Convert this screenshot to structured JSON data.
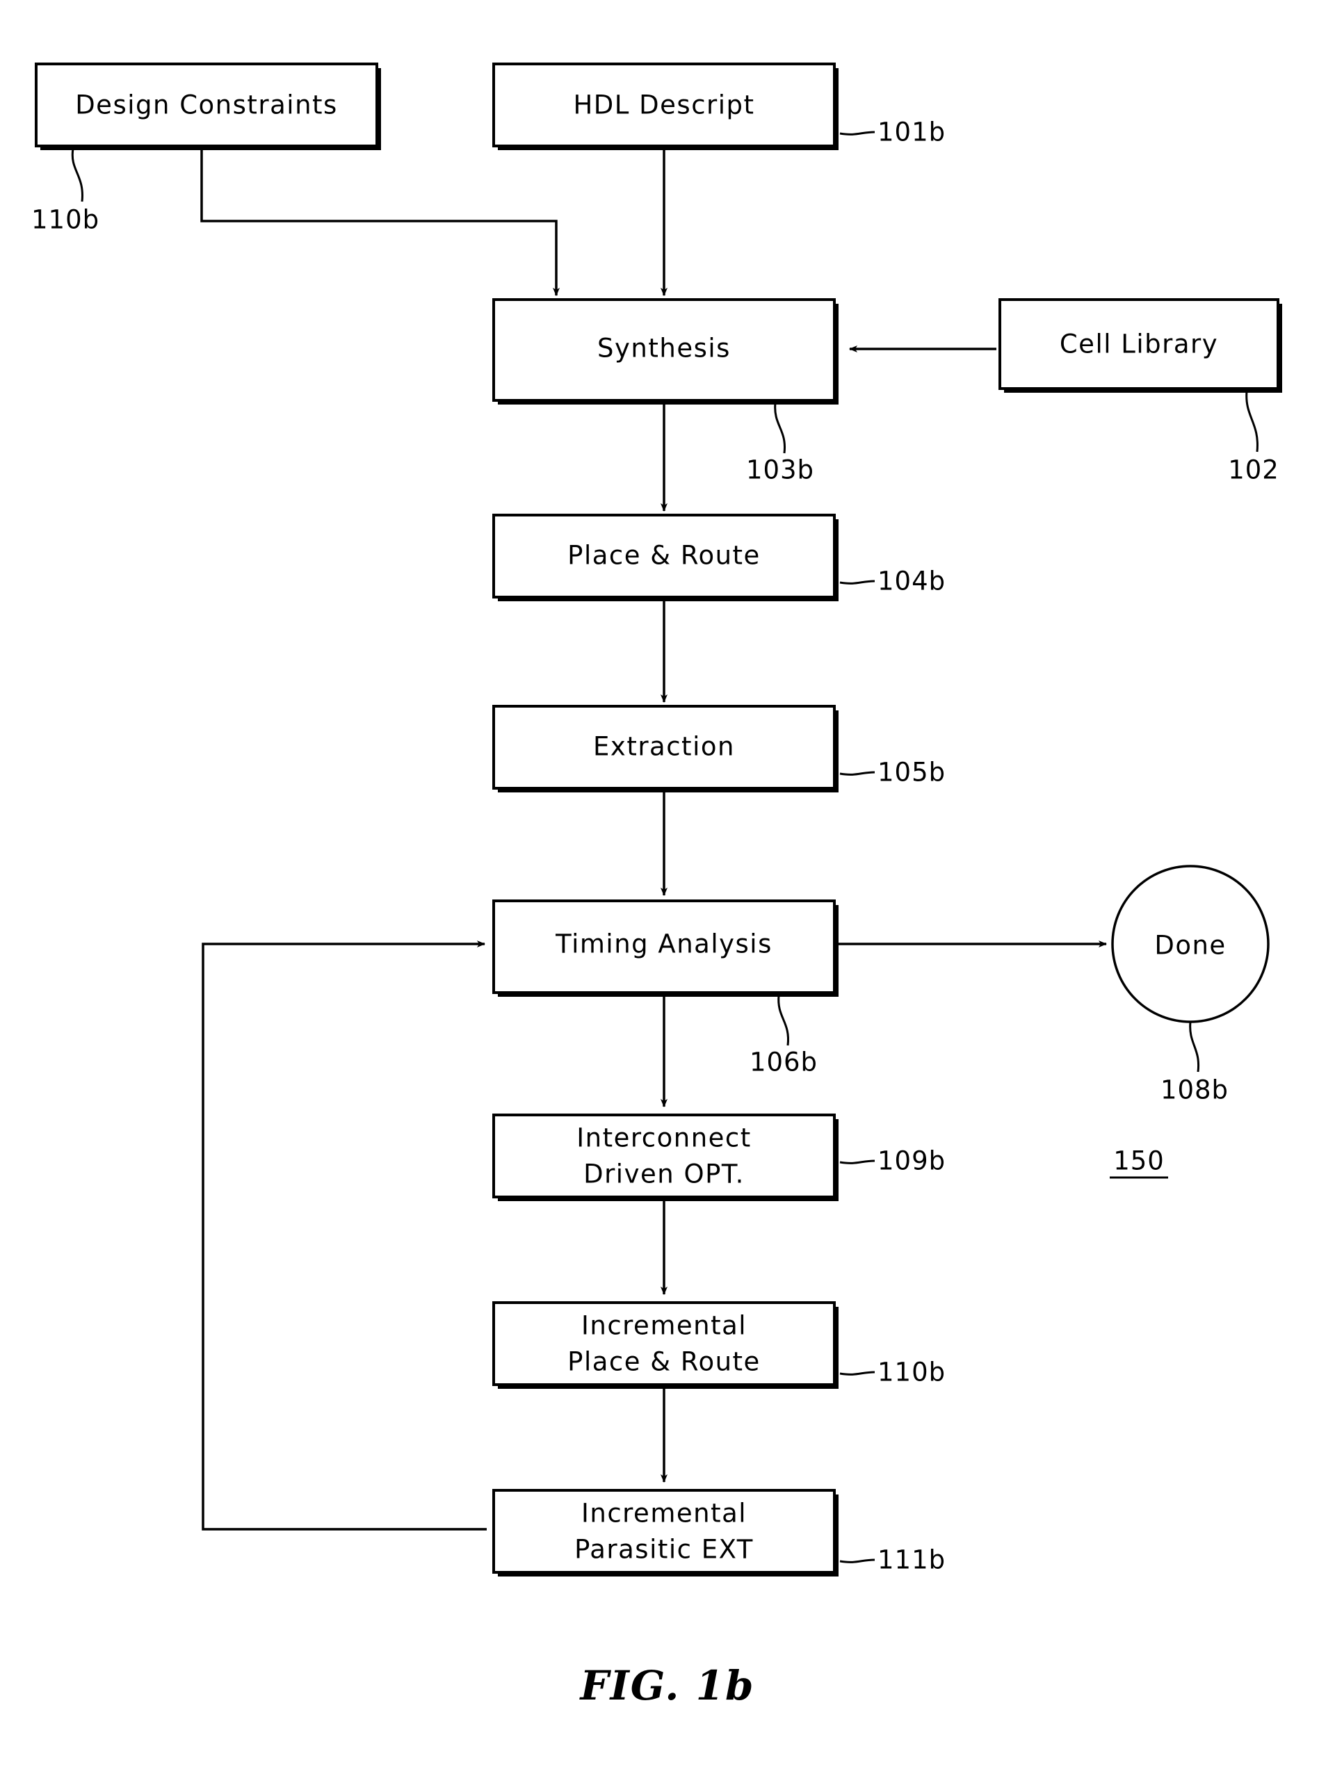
{
  "figure": {
    "caption": "FIG. 1b",
    "diagram_ref": "150"
  },
  "nodes": [
    {
      "id": "design-constraints",
      "label_line1": "Design Constraints",
      "label_line2": "",
      "ref": "110b",
      "shape": "rect"
    },
    {
      "id": "hdl-descript",
      "label_line1": "HDL Descript",
      "label_line2": "",
      "ref": "101b",
      "shape": "rect"
    },
    {
      "id": "synthesis",
      "label_line1": "Synthesis",
      "label_line2": "",
      "ref": "103b",
      "shape": "rect"
    },
    {
      "id": "cell-library",
      "label_line1": "Cell Library",
      "label_line2": "",
      "ref": "102",
      "shape": "rect"
    },
    {
      "id": "place-and-route",
      "label_line1": "Place & Route",
      "label_line2": "",
      "ref": "104b",
      "shape": "rect"
    },
    {
      "id": "extraction",
      "label_line1": "Extraction",
      "label_line2": "",
      "ref": "105b",
      "shape": "rect"
    },
    {
      "id": "timing-analysis",
      "label_line1": "Timing Analysis",
      "label_line2": "",
      "ref": "106b",
      "shape": "rect"
    },
    {
      "id": "done",
      "label_line1": "Done",
      "label_line2": "",
      "ref": "108b",
      "shape": "circle"
    },
    {
      "id": "interconnect-driven-opt",
      "label_line1": "Interconnect",
      "label_line2": "Driven OPT.",
      "ref": "109b",
      "shape": "rect"
    },
    {
      "id": "incremental-place-and-route",
      "label_line1": "Incremental",
      "label_line2": "Place & Route",
      "ref": "110b",
      "shape": "rect"
    },
    {
      "id": "incremental-parasitic-ext",
      "label_line1": "Incremental",
      "label_line2": "Parasitic EXT",
      "ref": "111b",
      "shape": "rect"
    }
  ],
  "edges": [
    {
      "from": "hdl-descript",
      "to": "synthesis"
    },
    {
      "from": "design-constraints",
      "to": "synthesis"
    },
    {
      "from": "cell-library",
      "to": "synthesis"
    },
    {
      "from": "synthesis",
      "to": "place-and-route"
    },
    {
      "from": "place-and-route",
      "to": "extraction"
    },
    {
      "from": "extraction",
      "to": "timing-analysis"
    },
    {
      "from": "timing-analysis",
      "to": "done"
    },
    {
      "from": "timing-analysis",
      "to": "interconnect-driven-opt"
    },
    {
      "from": "interconnect-driven-opt",
      "to": "incremental-place-and-route"
    },
    {
      "from": "incremental-place-and-route",
      "to": "incremental-parasitic-ext"
    },
    {
      "from": "incremental-parasitic-ext",
      "to": "timing-analysis"
    }
  ],
  "colors": {
    "stroke": "#000000",
    "fill": "#ffffff"
  }
}
